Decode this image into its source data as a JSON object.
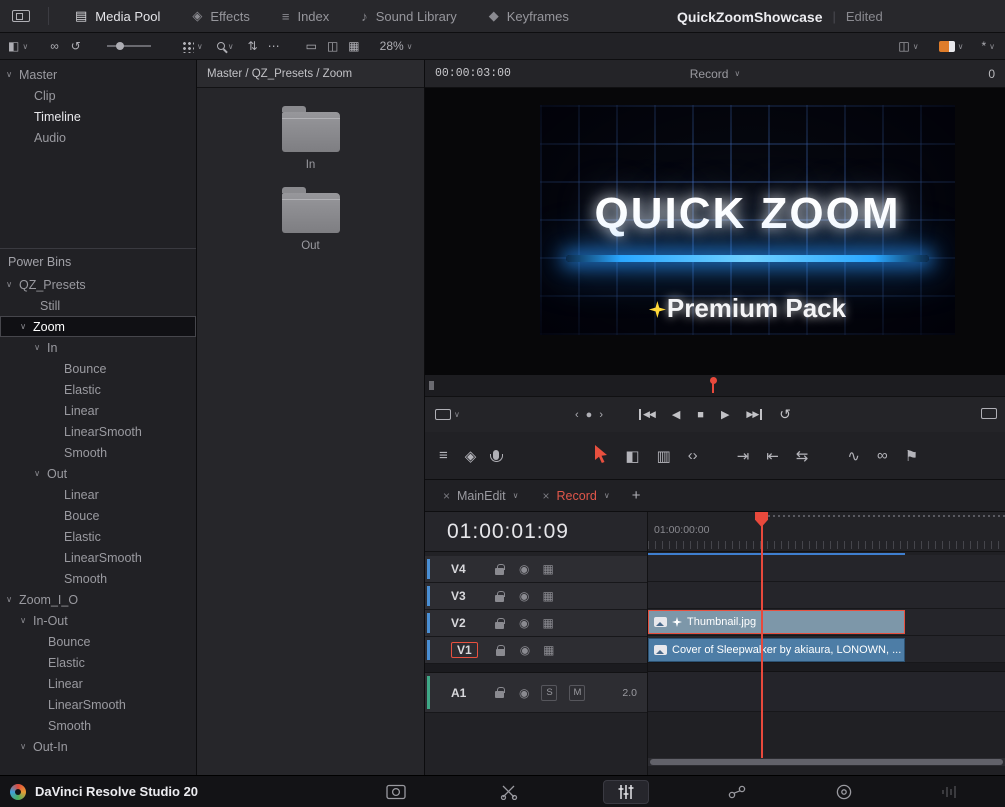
{
  "icons": {
    "chevron": "∨",
    "close": "×",
    "plus": "+",
    "more": "⋯",
    "sort": "⇅",
    "loop": "↺",
    "play": "▶",
    "stop": "■",
    "reverse": "◀",
    "rewind": "◀◀",
    "forward": "▶▶",
    "jog_left": "‹",
    "jog_right": "›",
    "jog_dot": "●",
    "menu": "≡",
    "keyframe": "◆",
    "effects": "◈",
    "note": "♪",
    "media_pool": "▤",
    "film": "▦",
    "panel": "◧",
    "display": "◫",
    "monitor": "▭",
    "auto_select": "◉",
    "overlay": "◈",
    "trim": "◧",
    "razor": "▥",
    "dynamic_trim": "‹›",
    "insert": "⇥",
    "overwrite": "⇤",
    "replace": "⇆",
    "curve": "∿",
    "link": "∞",
    "flag": "⚑",
    "asterisk": "*"
  },
  "top_bar": {
    "tabs": [
      "Media Pool",
      "Effects",
      "Index",
      "Sound Library",
      "Keyframes"
    ],
    "title": "QuickZoomShowcase",
    "status": "Edited"
  },
  "media_toolbar": {
    "zoom_level": "28%"
  },
  "bins": {
    "power_header": "Power Bins",
    "master": [
      "Master",
      "Clip",
      "Timeline",
      "Audio"
    ],
    "power": [
      "QZ_Presets",
      "Still",
      "Zoom",
      "In",
      "Bounce",
      "Elastic",
      "Linear",
      "LinearSmooth",
      "Smooth",
      "Out",
      "Linear",
      "Bouce",
      "Elastic",
      "LinearSmooth",
      "Smooth",
      "Zoom_I_O",
      "In-Out",
      "Bounce",
      "Elastic",
      "Linear",
      "LinearSmooth",
      "Smooth",
      "Out-In"
    ]
  },
  "contents": {
    "breadcrumb": "Master / QZ_Presets / Zoom",
    "folders": [
      "In",
      "Out"
    ]
  },
  "viewer": {
    "timecode": "00:00:03:00",
    "timeline_name": "Record",
    "corner": "0",
    "video_title": "QUICK ZOOM",
    "video_subtitle": "Premium Pack"
  },
  "timeline": {
    "tabs": [
      "MainEdit",
      "Record"
    ],
    "playhead_timecode": "01:00:01:09",
    "ruler_timecode": "01:00:00:00",
    "tracks": [
      "V4",
      "V3",
      "V2",
      "V1",
      "A1"
    ],
    "solo": "S",
    "mute": "M",
    "audio_format": "2.0",
    "clips": {
      "v2": "Thumbnail.jpg",
      "v1": "Cover of Sleepwalker by akiaura, LONOWN, ..."
    }
  },
  "status_bar": {
    "app_title": "DaVinci Resolve Studio 20"
  }
}
